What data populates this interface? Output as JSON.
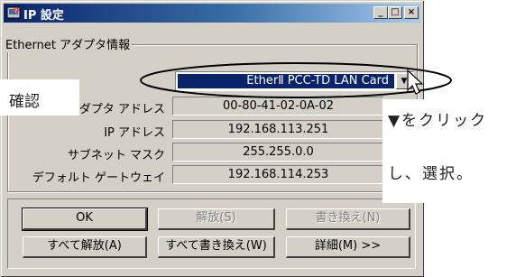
{
  "window": {
    "title": "IP 設定",
    "minimize_glyph": "_",
    "maximize_glyph": "□",
    "close_glyph": "×"
  },
  "group": {
    "label": "Ethernet アダプタ情報",
    "adapter_selected": "EtherⅡ PCC-TD LAN Card",
    "arrow_glyph": "▼"
  },
  "fields": [
    {
      "label": "アダプタ アドレス",
      "value": "00-80-41-02-0A-02"
    },
    {
      "label": "IP アドレス",
      "value": "192.168.113.251"
    },
    {
      "label": "サブネット マスク",
      "value": "255.255.0.0"
    },
    {
      "label": "デフォルト ゲートウェイ",
      "value": "192.168.114.253"
    }
  ],
  "buttons": {
    "ok": "OK",
    "release": "解放(S)",
    "renew": "書き換え(N)",
    "release_all": "すべて解放(A)",
    "renew_all": "すべて書き換え(W)",
    "details": "詳細(M) >>"
  },
  "annotations": {
    "confirm": "確認",
    "instruction_line1": "▼をクリック",
    "instruction_line2": "し、選択。"
  }
}
